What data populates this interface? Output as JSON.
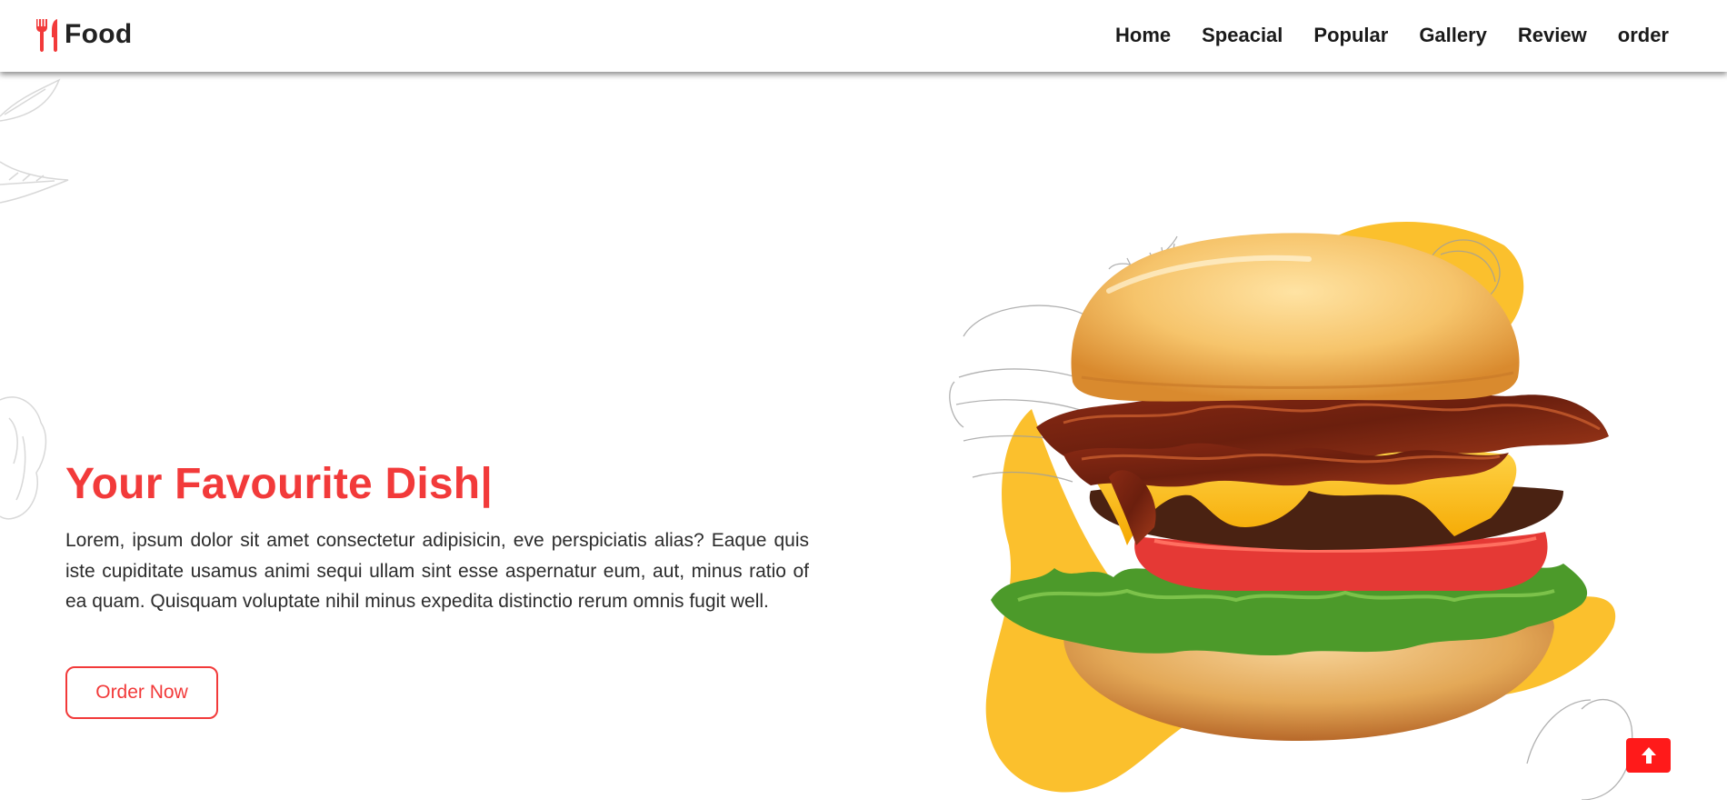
{
  "header": {
    "logo_icon": "utensils-icon",
    "logo_text": "Food",
    "nav": [
      {
        "label": "Home"
      },
      {
        "label": "Speacial"
      },
      {
        "label": "Popular"
      },
      {
        "label": "Gallery"
      },
      {
        "label": "Review"
      },
      {
        "label": "order"
      }
    ]
  },
  "hero": {
    "title": "Your Favourite Dish",
    "caret": "|",
    "description": "Lorem, ipsum dolor sit amet consectetur adipisicin, eve perspiciatis alias? Eaque quis iste cupiditate usamus animi sequi ullam sint esse aspernatur eum, aut, minus ratio of ea quam. Quisquam voluptate nihil minus expedita distinctio rerum omnis fugit well.",
    "button_label": "Order Now",
    "image": "burger-image"
  },
  "scroll_top": {
    "icon": "arrow-up-icon"
  },
  "colors": {
    "accent": "#f23a3a",
    "blob": "#fbc02d",
    "scroll_button": "#ff1a1a"
  }
}
